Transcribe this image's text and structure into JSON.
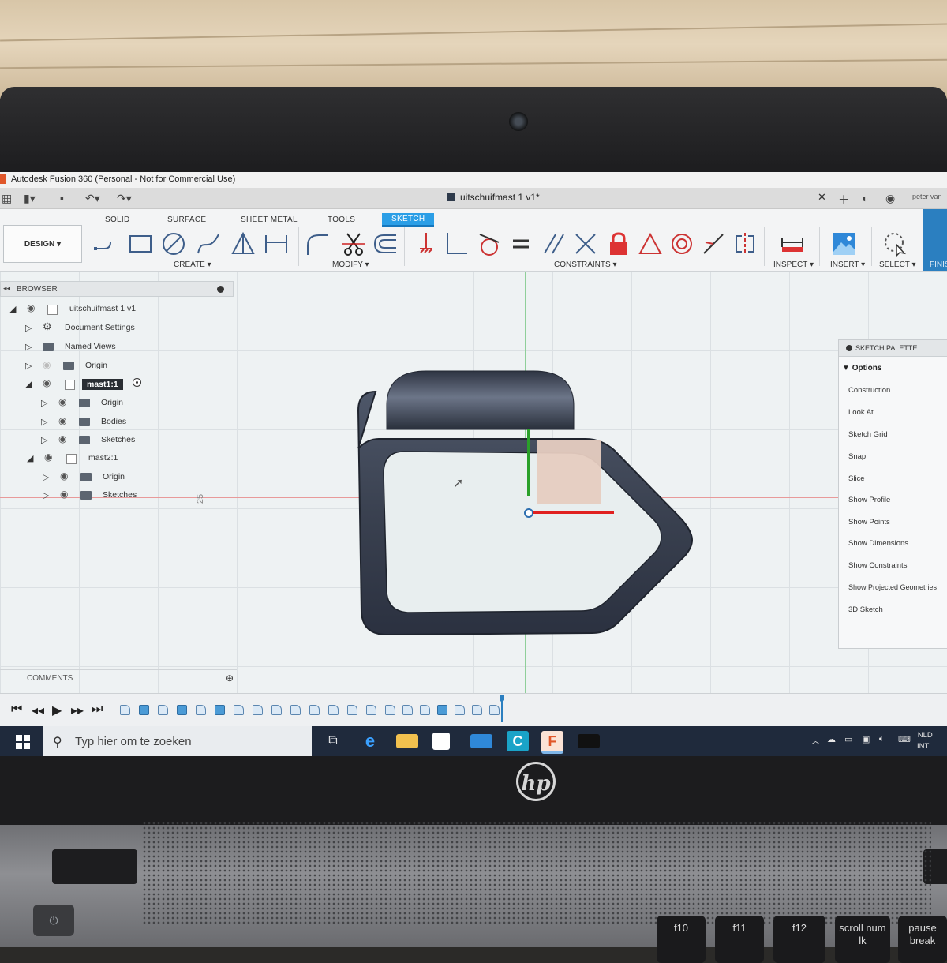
{
  "window": {
    "title": "Autodesk Fusion 360 (Personal - Not for Commercial Use)",
    "document_title": "uitschuifmast 1 v1*",
    "user": "peter van"
  },
  "ribbon": {
    "tabs": [
      "SOLID",
      "SURFACE",
      "SHEET METAL",
      "TOOLS",
      "SKETCH"
    ],
    "active_tab": "SKETCH",
    "workspace_button": "DESIGN",
    "groups": {
      "create": "CREATE",
      "modify": "MODIFY",
      "constraints": "CONSTRAINTS",
      "inspect": "INSPECT",
      "insert": "INSERT",
      "select": "SELECT",
      "finish": "FINIS"
    }
  },
  "browser": {
    "title": "BROWSER",
    "nodes": [
      {
        "label": "uitschuifmast 1 v1"
      },
      {
        "label": "Document Settings"
      },
      {
        "label": "Named Views"
      },
      {
        "label": "Origin"
      },
      {
        "label": "mast1:1"
      },
      {
        "label": "Origin"
      },
      {
        "label": "Bodies"
      },
      {
        "label": "Sketches"
      },
      {
        "label": "mast2:1"
      },
      {
        "label": "Origin"
      },
      {
        "label": "Sketches"
      }
    ]
  },
  "canvas": {
    "ruler_label": "25"
  },
  "sketch_palette": {
    "title": "SKETCH PALETTE",
    "section": "Options",
    "options": [
      "Construction",
      "Look At",
      "Sketch Grid",
      "Snap",
      "Slice",
      "Show Profile",
      "Show Points",
      "Show Dimensions",
      "Show Constraints",
      "Show Projected Geometries",
      "3D Sketch"
    ]
  },
  "comments": {
    "title": "COMMENTS"
  },
  "taskbar": {
    "search_placeholder": "Typ hier om te zoeken",
    "language_line1": "NLD",
    "language_line2": "INTL"
  },
  "laptop": {
    "brand": "hp",
    "keys": [
      "f10",
      "f11",
      "f12",
      "scroll num lk",
      "pause break"
    ]
  },
  "colors": {
    "accent": "#2b9ee6",
    "body_dark": "#3a4150",
    "profile_fill": "#e6ccc0",
    "axis_red": "#e02020",
    "axis_green": "#2aa02a"
  }
}
